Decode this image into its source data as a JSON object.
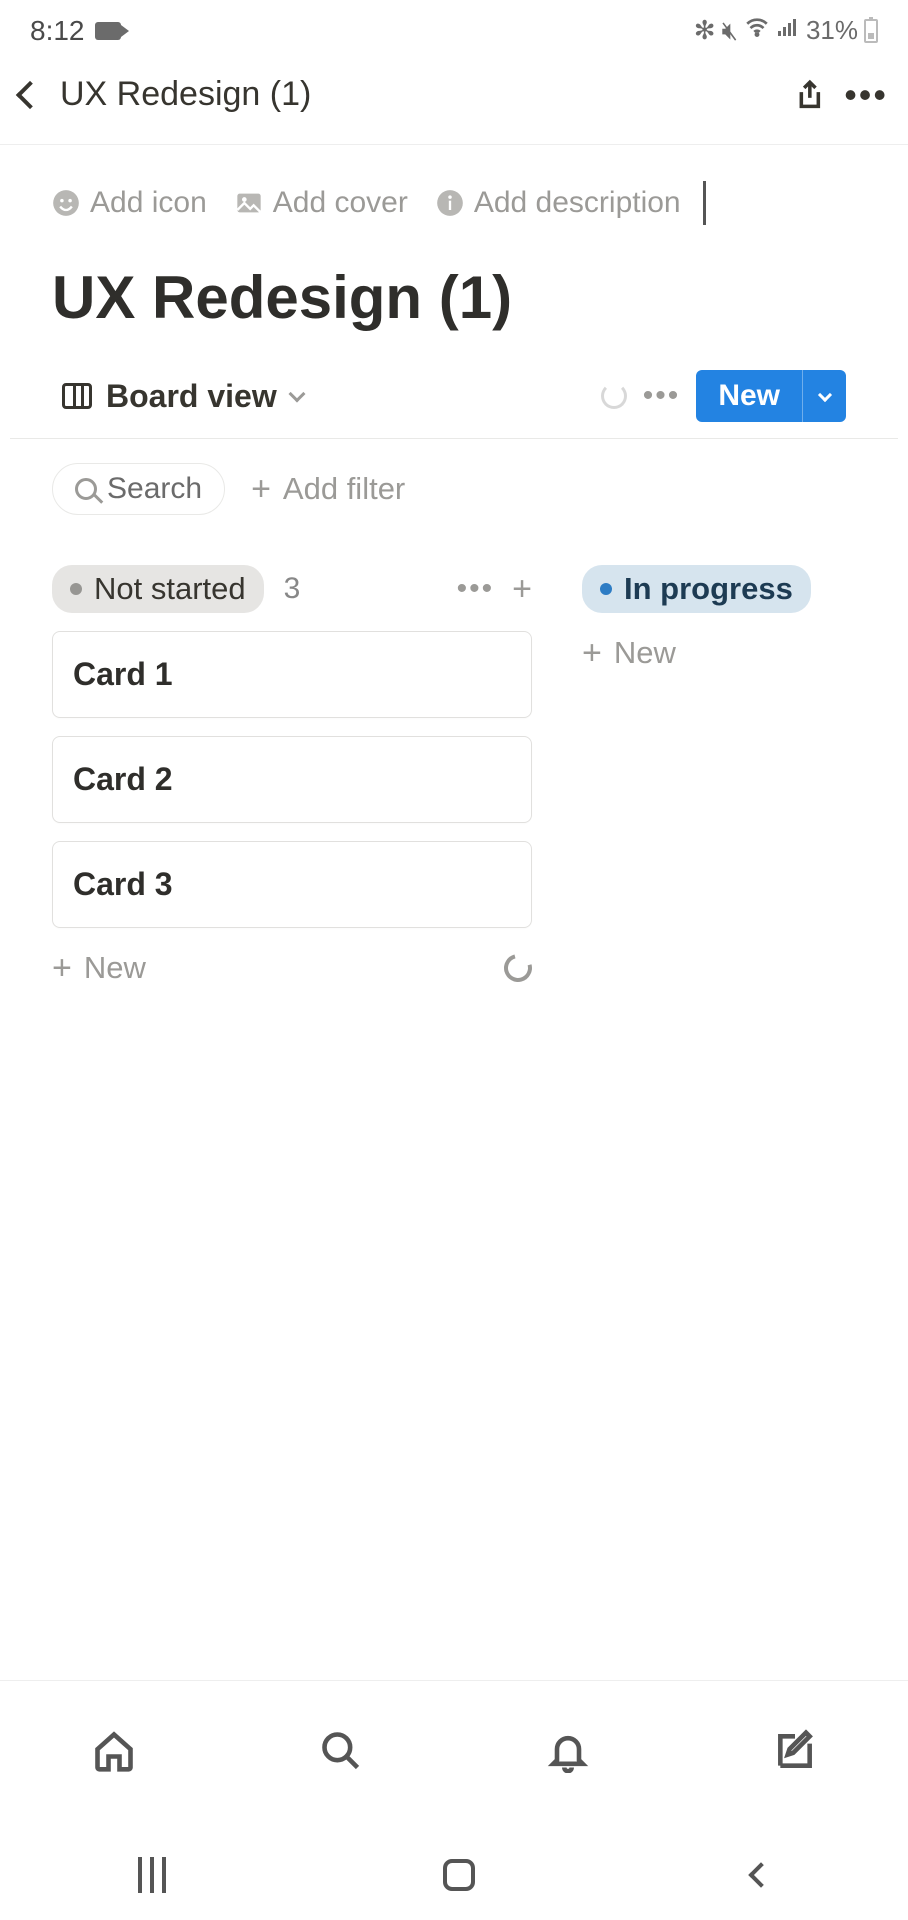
{
  "status_bar": {
    "time": "8:12",
    "battery_text": "31%"
  },
  "header": {
    "title": "UX Redesign (1)"
  },
  "meta": {
    "add_icon": "Add icon",
    "add_cover": "Add cover",
    "add_description": "Add description"
  },
  "page": {
    "title": "UX Redesign (1)"
  },
  "db": {
    "view_label": "Board view",
    "new_label": "New",
    "search_label": "Search",
    "add_filter_label": "Add filter"
  },
  "columns": [
    {
      "status": "Not started",
      "color": "grey",
      "count": "3",
      "cards": [
        "Card 1",
        "Card 2",
        "Card 3"
      ],
      "new_label": "New"
    },
    {
      "status": "In progress",
      "color": "blue",
      "count": "",
      "cards": [],
      "new_label": "New"
    }
  ]
}
